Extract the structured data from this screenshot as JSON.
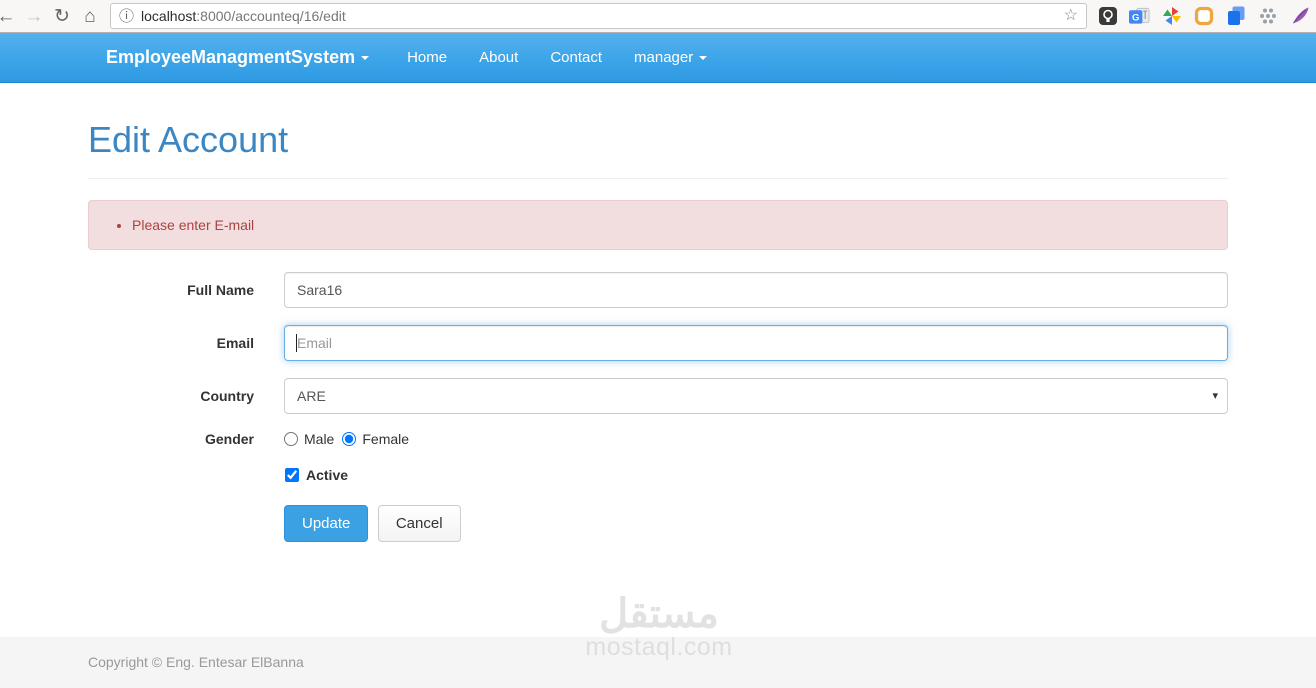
{
  "browser": {
    "url": {
      "host": "localhost",
      "path": ":8000/accounteq/16/edit"
    },
    "icons": {
      "back": "←",
      "forward": "→",
      "refresh": "↻",
      "home": "⌂",
      "info": "ⓘ",
      "star": "☆",
      "select_caret": "▾"
    }
  },
  "navbar": {
    "brand": "EmployeeManagmentSystem",
    "items": [
      {
        "label": "Home"
      },
      {
        "label": "About"
      },
      {
        "label": "Contact"
      },
      {
        "label": "manager"
      }
    ]
  },
  "page": {
    "title": "Edit Account",
    "alert": {
      "message": "Please enter E-mail"
    },
    "form": {
      "full_name": {
        "label": "Full Name",
        "value": "Sara16"
      },
      "email": {
        "label": "Email",
        "placeholder": "Email",
        "value": ""
      },
      "country": {
        "label": "Country",
        "value": "ARE"
      },
      "gender": {
        "label": "Gender",
        "options": [
          {
            "label": "Male",
            "selected": false
          },
          {
            "label": "Female",
            "selected": true
          }
        ]
      },
      "active": {
        "label": "Active",
        "checked": true
      },
      "buttons": {
        "update": "Update",
        "cancel": "Cancel"
      }
    }
  },
  "watermark": {
    "arabic": "مستقل",
    "latin": "mostaql.com"
  },
  "footer": {
    "copyright": "Copyright © Eng. Entesar ElBanna"
  },
  "colors": {
    "navbar_top": "#55b1ee",
    "navbar_bottom": "#2f9ae3",
    "heading": "#3a87c4",
    "alert_bg": "#f2dede",
    "alert_text": "#a94442",
    "primary_button": "#3ba1e3",
    "focus_border": "#66afe9",
    "footer_bg": "#f5f5f5"
  }
}
